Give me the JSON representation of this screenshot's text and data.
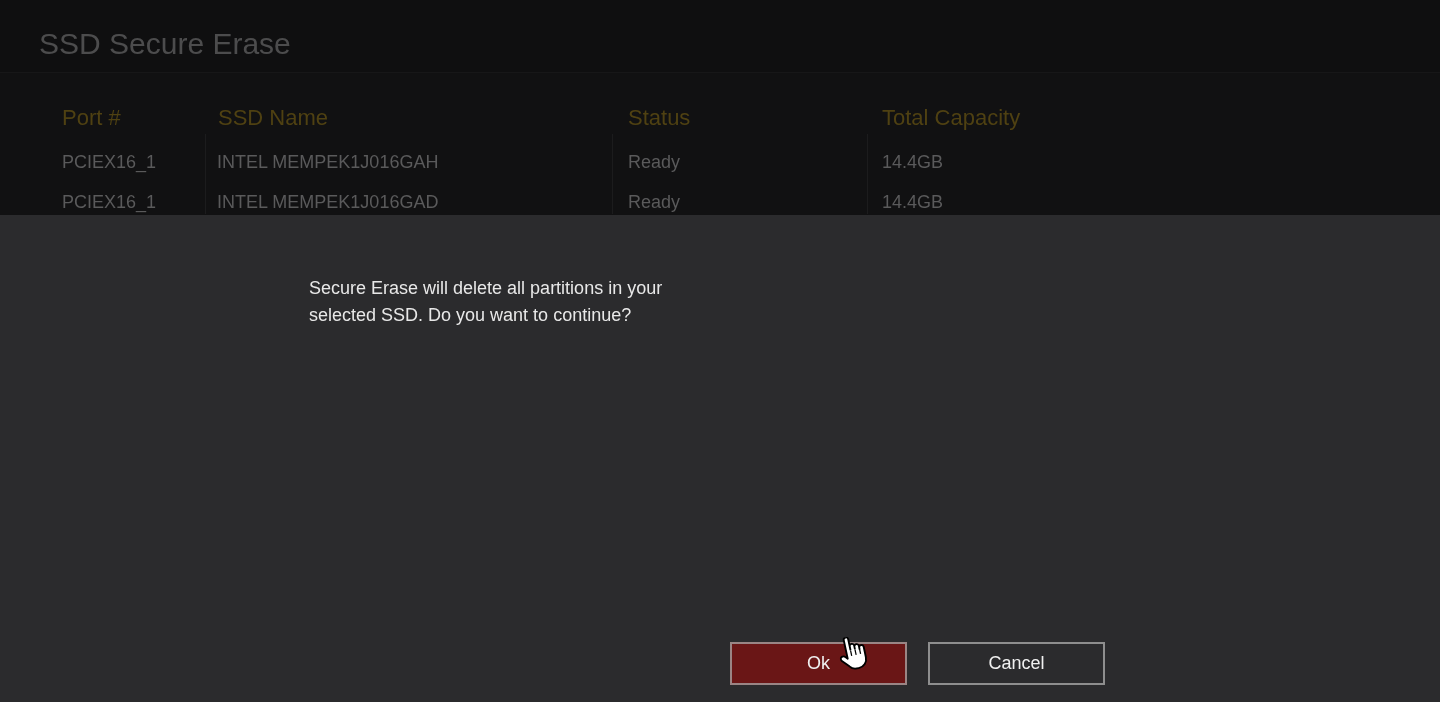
{
  "page": {
    "title": "SSD Secure Erase"
  },
  "table": {
    "columns": [
      "Port #",
      "SSD Name",
      "Status",
      "Total Capacity"
    ],
    "rows": [
      {
        "cells": [
          "PCIEX16_1",
          "INTEL MEMPEK1J016GAH",
          "Ready",
          "14.4GB"
        ]
      },
      {
        "cells": [
          "PCIEX16_1",
          "INTEL MEMPEK1J016GAD",
          "Ready",
          "14.4GB"
        ]
      }
    ]
  },
  "dialog": {
    "message": "Secure Erase will delete all partitions in your selected SSD. Do you want to continue?",
    "buttons": [
      {
        "label": "Ok",
        "selected": true
      },
      {
        "label": "Cancel",
        "selected": false
      }
    ]
  }
}
